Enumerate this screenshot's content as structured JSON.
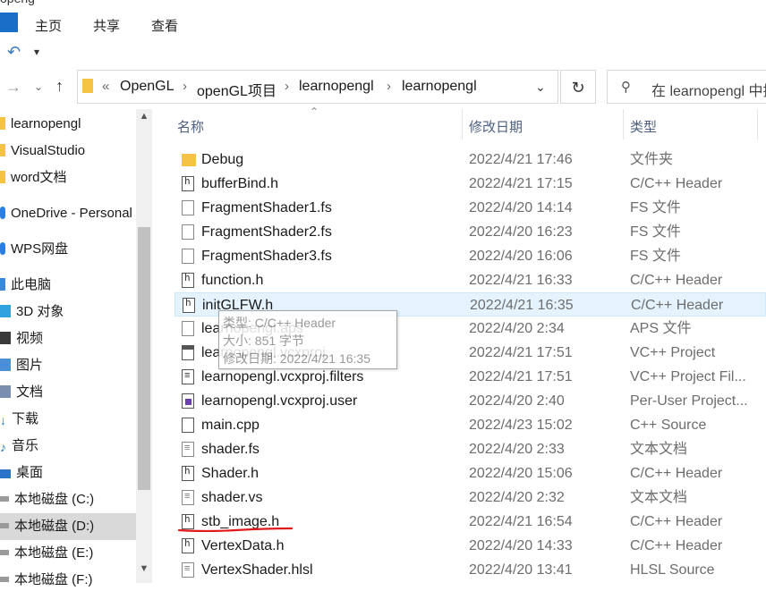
{
  "ribbon": {
    "title": "openg",
    "tabs": [
      "主页",
      "共享",
      "查看"
    ]
  },
  "address": {
    "prefix": "«",
    "crumbs": [
      "OpenGL",
      "openGL项目",
      "learnopengl",
      "learnopengl"
    ],
    "search_placeholder": "在 learnopengl 中搜"
  },
  "sidebar": {
    "items": [
      {
        "label": "learnopengl",
        "icon": "folder-icon"
      },
      {
        "label": "VisualStudio",
        "icon": "folder-icon"
      },
      {
        "label": "word文档",
        "icon": "folder-icon"
      },
      {
        "label": "OneDrive - Personal",
        "icon": "onedrive-icon"
      },
      {
        "label": "WPS网盘",
        "icon": "wps-cloud-icon"
      },
      {
        "label": "此电脑",
        "icon": "computer-icon"
      },
      {
        "label": "3D 对象",
        "icon": "3d-objects-icon"
      },
      {
        "label": "视频",
        "icon": "video-icon"
      },
      {
        "label": "图片",
        "icon": "pictures-icon"
      },
      {
        "label": "文档",
        "icon": "documents-icon"
      },
      {
        "label": "下载",
        "icon": "download-icon"
      },
      {
        "label": "音乐",
        "icon": "music-icon"
      },
      {
        "label": "桌面",
        "icon": "desktop-icon"
      },
      {
        "label": "本地磁盘 (C:)",
        "icon": "drive-icon"
      },
      {
        "label": "本地磁盘 (D:)",
        "icon": "drive-icon",
        "selected": true
      },
      {
        "label": "本地磁盘 (E:)",
        "icon": "drive-icon"
      },
      {
        "label": "本地磁盘 (F:)",
        "icon": "drive-icon"
      }
    ]
  },
  "columns": {
    "name": "名称",
    "date": "修改日期",
    "type": "类型"
  },
  "files": [
    {
      "name": "Debug",
      "date": "2022/4/21 17:46",
      "type": "文件夹",
      "icon": "folder-icon"
    },
    {
      "name": "bufferBind.h",
      "date": "2022/4/21 17:15",
      "type": "C/C++ Header",
      "icon": "header-file-icon"
    },
    {
      "name": "FragmentShader1.fs",
      "date": "2022/4/20 14:14",
      "type": "FS 文件",
      "icon": "blank-file-icon"
    },
    {
      "name": "FragmentShader2.fs",
      "date": "2022/4/20 16:23",
      "type": "FS 文件",
      "icon": "blank-file-icon"
    },
    {
      "name": "FragmentShader3.fs",
      "date": "2022/4/20 16:06",
      "type": "FS 文件",
      "icon": "blank-file-icon"
    },
    {
      "name": "function.h",
      "date": "2022/4/21 16:33",
      "type": "C/C++ Header",
      "icon": "header-file-icon"
    },
    {
      "name": "initGLFW.h",
      "date": "2022/4/21 16:35",
      "type": "C/C++ Header",
      "icon": "header-file-icon",
      "hover": true
    },
    {
      "name": "learnopengl.aps",
      "date": "2022/4/20 2:34",
      "type": "APS 文件",
      "icon": "blank-file-icon"
    },
    {
      "name": "learnopengl.vcxproj",
      "date": "2022/4/21 17:51",
      "type": "VC++ Project",
      "icon": "project-file-icon"
    },
    {
      "name": "learnopengl.vcxproj.filters",
      "date": "2022/4/21 17:51",
      "type": "VC++ Project Fil...",
      "icon": "filters-file-icon"
    },
    {
      "name": "learnopengl.vcxproj.user",
      "date": "2022/4/20 2:40",
      "type": "Per-User Project...",
      "icon": "user-file-icon"
    },
    {
      "name": "main.cpp",
      "date": "2022/4/23 15:02",
      "type": "C++ Source",
      "icon": "cpp-file-icon"
    },
    {
      "name": "shader.fs",
      "date": "2022/4/20 2:33",
      "type": "文本文档",
      "icon": "text-file-icon"
    },
    {
      "name": "Shader.h",
      "date": "2022/4/20 15:06",
      "type": "C/C++ Header",
      "icon": "header-file-icon"
    },
    {
      "name": "shader.vs",
      "date": "2022/4/20 2:32",
      "type": "文本文档",
      "icon": "text-file-icon"
    },
    {
      "name": "stb_image.h",
      "date": "2022/4/21 16:54",
      "type": "C/C++ Header",
      "icon": "header-file-icon"
    },
    {
      "name": "VertexData.h",
      "date": "2022/4/20 14:33",
      "type": "C/C++ Header",
      "icon": "header-file-icon"
    },
    {
      "name": "VertexShader.hlsl",
      "date": "2022/4/20 13:41",
      "type": "HLSL Source",
      "icon": "text-file-icon"
    }
  ],
  "tooltip": {
    "type_line": "类型: C/C++ Header",
    "size_line": "大小: 851 字节",
    "date_line": "修改日期: 2022/4/21 16:35"
  },
  "annotation": {
    "color": "#e0191b"
  },
  "colors": {
    "accent": "#1a6ec7",
    "hover": "#e5f3ff",
    "selected": "#d9d9d9"
  }
}
